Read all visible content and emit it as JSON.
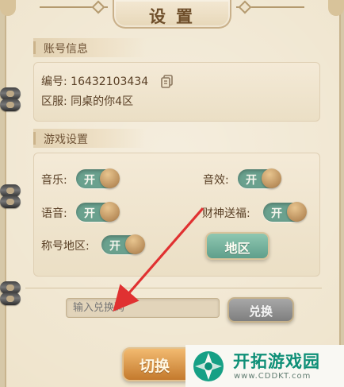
{
  "title": "设置",
  "account": {
    "header": "账号信息",
    "id_line": "编号: 16432103434",
    "server_line": "区服: 同桌的你4区"
  },
  "game_settings": {
    "header": "游戏设置",
    "items": [
      {
        "label": "音乐:",
        "state": "开"
      },
      {
        "label": "音效:",
        "state": "开"
      },
      {
        "label": "语音:",
        "state": "开"
      },
      {
        "label": "财神送福:",
        "state": "开"
      },
      {
        "label": "称号地区:",
        "state": "开"
      }
    ],
    "region_button": "地区"
  },
  "redeem": {
    "placeholder": "输入兑换码",
    "button": "兑换"
  },
  "switch_button": "切换",
  "watermark": {
    "main": "开拓游戏园",
    "sub": "www.CDDKT.com"
  },
  "colors": {
    "toggle_on": "#6aa18e",
    "accent_gold": "#c47a2d",
    "paper": "#efe4cc"
  },
  "icons": [
    "copy-icon",
    "arrow-annotation",
    "watermark-logo"
  ]
}
